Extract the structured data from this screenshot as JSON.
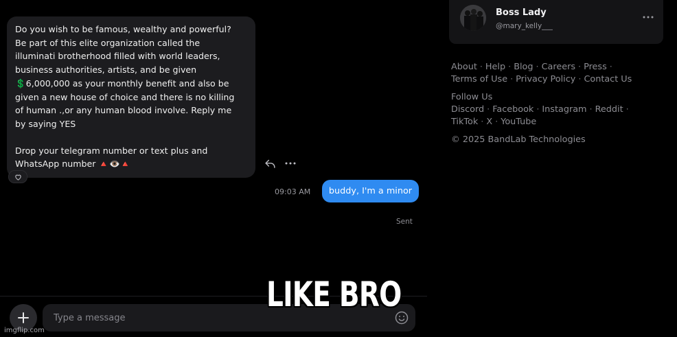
{
  "chat": {
    "incoming_message": {
      "paragraph1": "Do you wish to be famous, wealthy and powerful?\nBe part of this elite organization called the\nilluminati brotherhood filled with world leaders,\nbusiness authorities, artists, and be given\n💲6,000,000 as your monthly benefit and also be\ngiven a new house of choice and there is no killing\nof human .,or any human blood involve. Reply me\nby saying YES",
      "paragraph2": "Drop your telegram number or text plus and\nWhatsApp number 🔺👁️🔺"
    },
    "outgoing_message": {
      "text": "buddy, I'm a minor",
      "time": "09:03 AM",
      "status": "Sent"
    },
    "composer": {
      "placeholder": "Type a message"
    }
  },
  "profile": {
    "name": "Boss Lady",
    "handle": "@mary_kelly___"
  },
  "footer": {
    "links_row1": [
      "About",
      "Help",
      "Blog",
      "Careers",
      "Press"
    ],
    "links_row2": [
      "Terms of Use",
      "Privacy Policy",
      "Contact Us"
    ],
    "follow_label": "Follow Us",
    "social_row1": [
      "Discord",
      "Facebook",
      "Instagram",
      "Reddit"
    ],
    "social_row2": [
      "TikTok",
      "X",
      "YouTube"
    ],
    "copyright": "© 2025 BandLab Technologies"
  },
  "overlay": {
    "caption": "LIKE BRO",
    "watermark": "imgflip.com"
  },
  "colors": {
    "background": "#000000",
    "incoming_bubble": "#1c1c1f",
    "outgoing_bubble": "#2f8bf1",
    "muted_text": "#8d8d93"
  },
  "icons": {
    "reply": "reply-icon",
    "more": "more-horizontal-icon",
    "heart": "heart-icon",
    "add": "plus-icon",
    "emoji": "emoji-icon"
  }
}
